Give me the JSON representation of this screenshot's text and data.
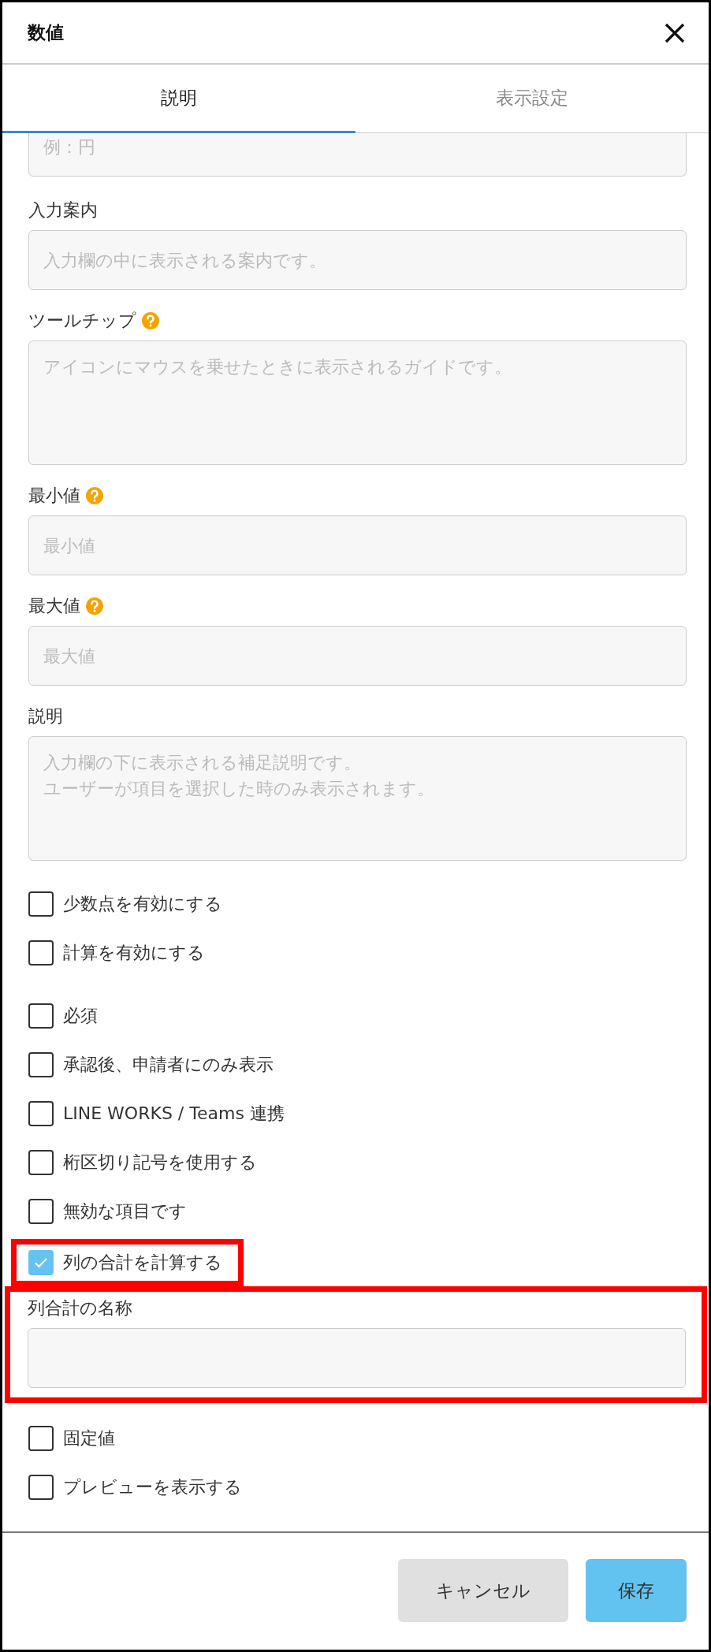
{
  "dialog": {
    "title": "数値"
  },
  "tabs": [
    {
      "label": "説明",
      "selected": true
    },
    {
      "label": "表示設定",
      "selected": false
    }
  ],
  "sections": [
    {
      "items": [
        {
          "kind": "input",
          "placeholder": "例：円",
          "clipped": true
        },
        {
          "kind": "input",
          "label": "入力案内",
          "placeholder": "入力欄の中に表示される案内です。"
        },
        {
          "kind": "textarea",
          "label": "ツールチップ",
          "help": true,
          "placeholder": "アイコンにマウスを乗せたときに表示されるガイドです。"
        },
        {
          "kind": "input",
          "label": "最小値",
          "help": true,
          "placeholder": "最小値"
        },
        {
          "kind": "input",
          "label": "最大値",
          "help": true,
          "placeholder": "最大値"
        },
        {
          "kind": "textarea",
          "label": "説明",
          "placeholder_lines": [
            "入力欄の下に表示される補足説明です。",
            "ユーザーが項目を選択した時のみ表示されます。"
          ]
        },
        {
          "kind": "checkbox",
          "label": "少数点を有効にする",
          "checked": false
        },
        {
          "kind": "checkbox",
          "label": "計算を有効にする",
          "checked": false
        }
      ]
    },
    {
      "items": [
        {
          "kind": "checkbox",
          "label": "必須",
          "checked": false
        },
        {
          "kind": "checkbox",
          "label": "承認後、申請者にのみ表示",
          "checked": false
        },
        {
          "kind": "checkbox",
          "label": "LINE WORKS / Teams 連携",
          "checked": false
        },
        {
          "kind": "checkbox",
          "label": "桁区切り記号を使用する",
          "checked": false
        },
        {
          "kind": "checkbox",
          "label": "無効な項目です",
          "checked": false
        },
        {
          "kind": "checkbox",
          "label": "列の合計を計算する",
          "checked": true,
          "highlighted": true
        },
        {
          "kind": "input",
          "label": "列合計の名称",
          "highlighted": true
        },
        {
          "kind": "checkbox",
          "label": "固定値",
          "checked": false
        },
        {
          "kind": "checkbox",
          "label": "プレビューを表示する",
          "checked": false
        }
      ]
    }
  ],
  "buttons": [
    {
      "label": "キャンセル",
      "kind": "secondary"
    },
    {
      "label": "保存",
      "kind": "primary"
    }
  ]
}
